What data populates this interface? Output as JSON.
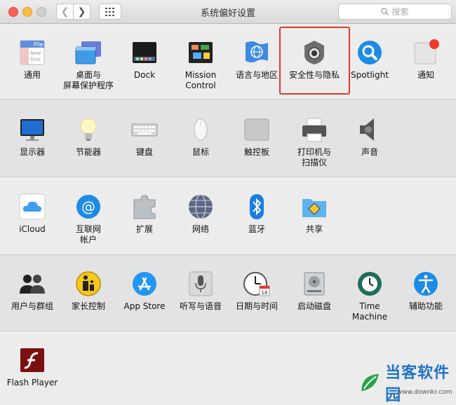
{
  "window": {
    "title": "系统偏好设置",
    "search_placeholder": "搜索"
  },
  "row1": [
    {
      "label": "通用",
      "icon": "general-icon"
    },
    {
      "label": "桌面与\n屏幕保护程序",
      "icon": "desktop-icon"
    },
    {
      "label": "Dock",
      "icon": "dock-icon"
    },
    {
      "label": "Mission\nControl",
      "icon": "mission-control-icon"
    },
    {
      "label": "语言与地区",
      "icon": "language-icon"
    },
    {
      "label": "安全性与隐私",
      "icon": "security-icon"
    },
    {
      "label": "Spotlight",
      "icon": "spotlight-icon"
    },
    {
      "label": "通知",
      "icon": "notifications-icon"
    }
  ],
  "row2": [
    {
      "label": "显示器",
      "icon": "display-icon"
    },
    {
      "label": "节能器",
      "icon": "energy-icon"
    },
    {
      "label": "键盘",
      "icon": "keyboard-icon"
    },
    {
      "label": "鼠标",
      "icon": "mouse-icon"
    },
    {
      "label": "触控板",
      "icon": "trackpad-icon"
    },
    {
      "label": "打印机与\n扫描仪",
      "icon": "printer-icon"
    },
    {
      "label": "声音",
      "icon": "sound-icon"
    }
  ],
  "row3": [
    {
      "label": "iCloud",
      "icon": "icloud-icon"
    },
    {
      "label": "互联网\n帐户",
      "icon": "internet-accounts-icon"
    },
    {
      "label": "扩展",
      "icon": "extensions-icon"
    },
    {
      "label": "网络",
      "icon": "network-icon"
    },
    {
      "label": "蓝牙",
      "icon": "bluetooth-icon"
    },
    {
      "label": "共享",
      "icon": "sharing-icon"
    }
  ],
  "row4": [
    {
      "label": "用户与群组",
      "icon": "users-icon"
    },
    {
      "label": "家长控制",
      "icon": "parental-icon"
    },
    {
      "label": "App Store",
      "icon": "appstore-icon"
    },
    {
      "label": "听写与语音",
      "icon": "dictation-icon"
    },
    {
      "label": "日期与时间",
      "icon": "datetime-icon"
    },
    {
      "label": "启动磁盘",
      "icon": "startup-disk-icon"
    },
    {
      "label": "Time Machine",
      "icon": "timemachine-icon"
    },
    {
      "label": "辅助功能",
      "icon": "accessibility-icon"
    }
  ],
  "row5": [
    {
      "label": "Flash Player",
      "icon": "flash-icon"
    }
  ],
  "icon_text": {
    "general_file": "File",
    "general_new": "New",
    "general_one": "One",
    "calendar_day": "18"
  },
  "watermark": {
    "name": "当客软件园",
    "url": "www.downkr.com"
  },
  "colors": {
    "highlight_border": "#e0382b",
    "accent_blue": "#1f73c8"
  }
}
